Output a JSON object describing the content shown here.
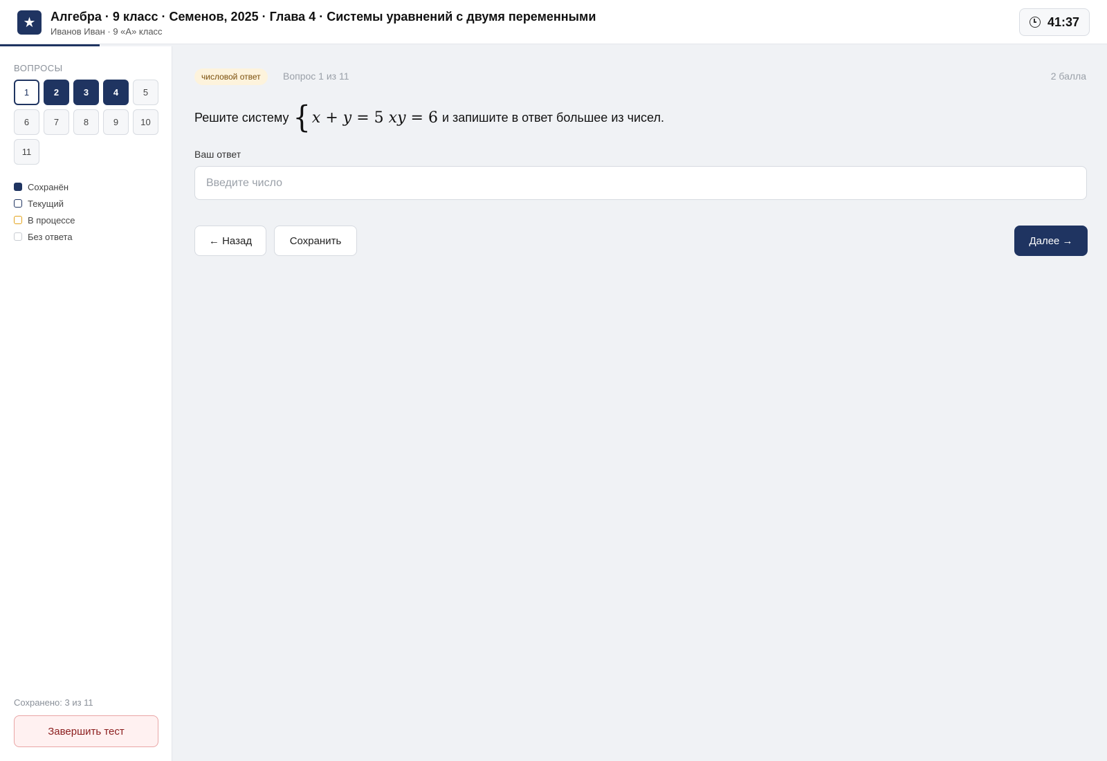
{
  "header": {
    "title": "Алгебра · 9 класс · Семенов, 2025 · Глава 4 · Системы уравнений с двумя переменными",
    "subtitle": "Иванов Иван · 9 «А» класс",
    "logo_icon": "star-icon",
    "timer": "41:37",
    "timer_icon": "clock-icon",
    "progress_fraction": 0.09
  },
  "sidebar": {
    "heading": "ВОПРОСЫ",
    "questions": [
      {
        "label": "1",
        "state": "current"
      },
      {
        "label": "2",
        "state": "saved"
      },
      {
        "label": "3",
        "state": "saved"
      },
      {
        "label": "4",
        "state": "saved"
      },
      {
        "label": "5",
        "state": "none"
      },
      {
        "label": "6",
        "state": "none"
      },
      {
        "label": "7",
        "state": "none"
      },
      {
        "label": "8",
        "state": "none"
      },
      {
        "label": "9",
        "state": "none"
      },
      {
        "label": "10",
        "state": "none"
      },
      {
        "label": "11",
        "state": "none"
      }
    ],
    "legend": [
      {
        "label": "Сохранён",
        "kind": "saved"
      },
      {
        "label": "Текущий",
        "kind": "current"
      },
      {
        "label": "В процессе",
        "kind": "progress"
      },
      {
        "label": "Без ответа",
        "kind": "none"
      }
    ],
    "saved_count": "Сохранено: 3 из 11",
    "finish_label": "Завершить тест"
  },
  "question": {
    "badge": "числовой ответ",
    "counter": "Вопрос 1 из 11",
    "points": "2 балла",
    "text_before": "Решите систему",
    "math": {
      "brace": "{",
      "eq1_lhs1": "x",
      "eq1_op": "+",
      "eq1_lhs2": "y",
      "eq1_eq": "=",
      "eq1_rhs": "5",
      "eq2_lhs": "xy",
      "eq2_eq": "=",
      "eq2_rhs": "6"
    },
    "text_after": "и запишите в ответ большее из чисел.",
    "answer_label": "Ваш ответ",
    "answer_value": "",
    "answer_placeholder": "Введите число"
  },
  "nav": {
    "back_label": "← Назад",
    "save_label": "Сохранить",
    "next_label": "Далее →"
  },
  "colors": {
    "accent": "#1f3461",
    "badge_bg": "#fdf3dc",
    "in_progress": "#e3a21a",
    "danger_bg": "#fff1f1",
    "danger_text": "#8b1d1d"
  }
}
